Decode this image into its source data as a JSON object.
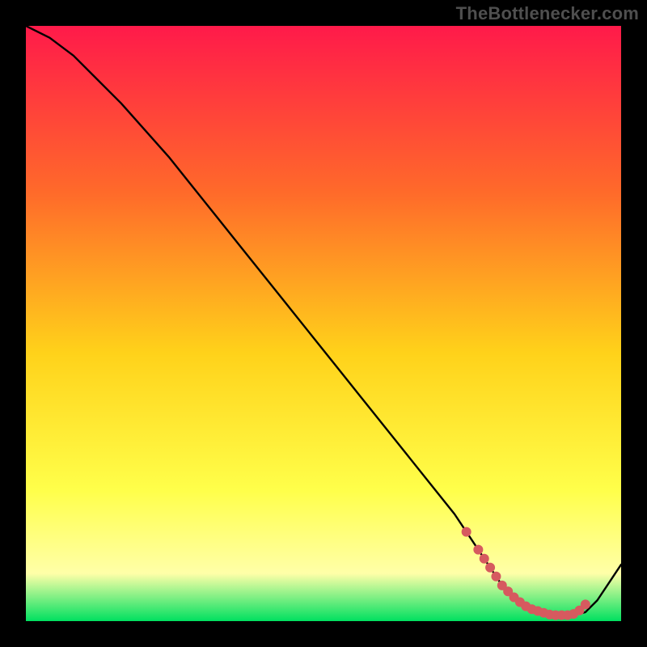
{
  "attribution": "TheBottlenecker.com",
  "colors": {
    "background_black": "#000000",
    "gradient_top": "#ff1a4a",
    "gradient_mid_upper": "#ff6a2a",
    "gradient_mid": "#ffd21a",
    "gradient_mid_lower": "#ffff4a",
    "gradient_lower": "#ffffa8",
    "gradient_bottom": "#00e060",
    "curve": "#000000",
    "marker_fill": "#d65a5f",
    "marker_stroke": "#d65a5f"
  },
  "chart_data": {
    "type": "line",
    "title": "",
    "xlabel": "",
    "ylabel": "",
    "xlim": [
      0,
      100
    ],
    "ylim": [
      0,
      100
    ],
    "grid": false,
    "legend_position": "none",
    "series": [
      {
        "name": "bottleneck-curve",
        "x": [
          0,
          4,
          8,
          12,
          16,
          20,
          24,
          28,
          32,
          36,
          40,
          44,
          48,
          52,
          56,
          60,
          64,
          68,
          72,
          74,
          76,
          78,
          80,
          82,
          84,
          86,
          88,
          90,
          92,
          94,
          96,
          98,
          100
        ],
        "values": [
          100,
          98,
          95,
          91,
          87,
          82.5,
          78,
          73,
          68,
          63,
          58,
          53,
          48,
          43,
          38,
          33,
          28,
          23,
          18,
          15,
          12,
          9,
          6,
          4,
          2.5,
          1.5,
          1,
          1,
          1,
          1.5,
          3.5,
          6.5,
          9.5
        ]
      }
    ],
    "markers": {
      "name": "highlight-dots",
      "x": [
        74,
        76,
        77,
        78,
        79,
        80,
        81,
        82,
        83,
        84,
        85,
        86,
        87,
        88,
        89,
        90,
        91,
        92,
        93,
        94
      ],
      "values": [
        15,
        12,
        10.5,
        9,
        7.5,
        6,
        5,
        4,
        3.2,
        2.5,
        2,
        1.7,
        1.4,
        1.1,
        1,
        1,
        1,
        1.2,
        1.8,
        2.8
      ]
    }
  }
}
